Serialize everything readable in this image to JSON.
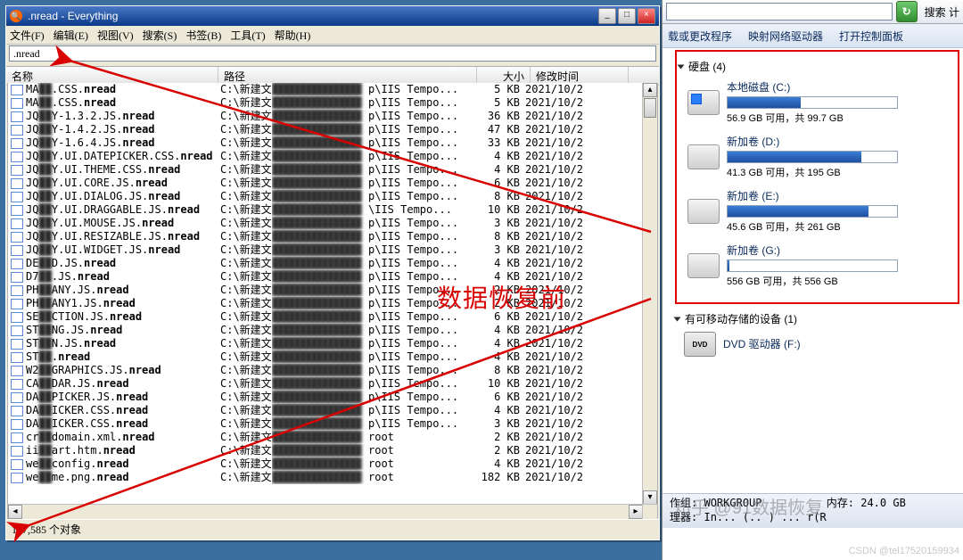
{
  "window": {
    "title": ".nread - Everything",
    "search_value": ".nread",
    "status": "167,585 个对象"
  },
  "menu": {
    "file": "文件(F)",
    "edit": "编辑(E)",
    "view": "视图(V)",
    "search": "搜索(S)",
    "bookmark": "书签(B)",
    "tool": "工具(T)",
    "help": "帮助(H)"
  },
  "cols": {
    "name": "名称",
    "path": "路径",
    "size": "大小",
    "date": "修改时间"
  },
  "overlay_text": "数据恢复前",
  "rows": [
    {
      "n1": "MA",
      "n2": ".CSS.",
      "n3": "nread",
      "pa": "C:\\新建文",
      "pb": "████████",
      "pc": "p\\IIS Tempo...",
      "sz": "5 KB",
      "dt": "2021/10/2"
    },
    {
      "n1": "MA",
      "n2": ".CSS.",
      "n3": "nread",
      "pa": "C:\\新建文",
      "pb": "████████",
      "pc": "p\\IIS Tempo...",
      "sz": "5 KB",
      "dt": "2021/10/2"
    },
    {
      "n1": "JQ",
      "n2": "Y-1.3.2.JS.",
      "n3": "nread",
      "pa": "C:\\新建文",
      "pb": "████████",
      "pc": "p\\IIS Tempo...",
      "sz": "36 KB",
      "dt": "2021/10/2"
    },
    {
      "n1": "JQ",
      "n2": "Y-1.4.2.JS.",
      "n3": "nread",
      "pa": "C:\\新建文",
      "pb": "████████",
      "pc": "p\\IIS Tempo...",
      "sz": "47 KB",
      "dt": "2021/10/2"
    },
    {
      "n1": "JQ",
      "n2": "Y-1.6.4.JS.",
      "n3": "nread",
      "pa": "C:\\新建文",
      "pb": "████████",
      "pc": "p\\IIS Tempo...",
      "sz": "33 KB",
      "dt": "2021/10/2"
    },
    {
      "n1": "JQ",
      "n2": "Y.UI.DATEPICKER.CSS.",
      "n3": "nread",
      "pa": "C:\\新建文",
      "pb": "████████",
      "pc": "p\\IIS Tempo...",
      "sz": "4 KB",
      "dt": "2021/10/2"
    },
    {
      "n1": "JQ",
      "n2": "Y.UI.THEME.CSS.",
      "n3": "nread",
      "pa": "C:\\新建文",
      "pb": "████████",
      "pc": "p\\IIS Tempo...",
      "sz": "4 KB",
      "dt": "2021/10/2"
    },
    {
      "n1": "JQ",
      "n2": "Y.UI.CORE.JS.",
      "n3": "nread",
      "pa": "C:\\新建文",
      "pb": "████████",
      "pc": "p\\IIS Tempo...",
      "sz": "6 KB",
      "dt": "2021/10/2"
    },
    {
      "n1": "JQ",
      "n2": "Y.UI.DIALOG.JS.",
      "n3": "nread",
      "pa": "C:\\新建文",
      "pb": "████████",
      "pc": "p\\IIS Tempo...",
      "sz": "8 KB",
      "dt": "2021/10/2"
    },
    {
      "n1": "JQ",
      "n2": "Y.UI.DRAGGABLE.JS.",
      "n3": "nread",
      "pa": "C:\\新建文",
      "pb": "████████",
      "pc": "\\IIS Tempo...",
      "sz": "10 KB",
      "dt": "2021/10/2"
    },
    {
      "n1": "JQ",
      "n2": "Y.UI.MOUSE.JS.",
      "n3": "nread",
      "pa": "C:\\新建文",
      "pb": "████████",
      "pc": "p\\IIS Tempo...",
      "sz": "3 KB",
      "dt": "2021/10/2"
    },
    {
      "n1": "JQ",
      "n2": "Y.UI.RESIZABLE.JS.",
      "n3": "nread",
      "pa": "C:\\新建文",
      "pb": "████████",
      "pc": "p\\IIS Tempo...",
      "sz": "8 KB",
      "dt": "2021/10/2"
    },
    {
      "n1": "JQ",
      "n2": "Y.UI.WIDGET.JS.",
      "n3": "nread",
      "pa": "C:\\新建文",
      "pb": "████████",
      "pc": "p\\IIS Tempo...",
      "sz": "3 KB",
      "dt": "2021/10/2"
    },
    {
      "n1": "DE",
      "n2": "D.JS.",
      "n3": "nread",
      "pa": "C:\\新建文",
      "pb": "████████",
      "pc": "p\\IIS Tempo...",
      "sz": "4 KB",
      "dt": "2021/10/2"
    },
    {
      "n1": "D7",
      "n2": ".JS.",
      "n3": "nread",
      "pa": "C:\\新建文",
      "pb": "████████",
      "pc": "p\\IIS Tempo...",
      "sz": "4 KB",
      "dt": "2021/10/2"
    },
    {
      "n1": "PH",
      "n2": "ANY.JS.",
      "n3": "nread",
      "pa": "C:\\新建文",
      "pb": "████████",
      "pc": "p\\IIS Tempo...",
      "sz": "2 KB",
      "dt": "2021/10/2"
    },
    {
      "n1": "PH",
      "n2": "ANY1.JS.",
      "n3": "nread",
      "pa": "C:\\新建文",
      "pb": "████████",
      "pc": "p\\IIS Tempo...",
      "sz": "2 KB",
      "dt": "2021/10/2"
    },
    {
      "n1": "SE",
      "n2": "CTION.JS.",
      "n3": "nread",
      "pa": "C:\\新建文",
      "pb": "████████",
      "pc": "p\\IIS Tempo...",
      "sz": "6 KB",
      "dt": "2021/10/2"
    },
    {
      "n1": "ST",
      "n2": "NG.JS.",
      "n3": "nread",
      "pa": "C:\\新建文",
      "pb": "████████",
      "pc": "p\\IIS Tempo...",
      "sz": "4 KB",
      "dt": "2021/10/2"
    },
    {
      "n1": "ST",
      "n2": "N.JS.",
      "n3": "nread",
      "pa": "C:\\新建文",
      "pb": "████████",
      "pc": "p\\IIS Tempo...",
      "sz": "4 KB",
      "dt": "2021/10/2"
    },
    {
      "n1": "ST",
      "n2": ".",
      "n3": "nread",
      "pa": "C:\\新建文",
      "pb": "████████",
      "pc": "p\\IIS Tempo...",
      "sz": "4 KB",
      "dt": "2021/10/2"
    },
    {
      "n1": "W2",
      "n2": "GRAPHICS.JS.",
      "n3": "nread",
      "pa": "C:\\新建文",
      "pb": "████████",
      "pc": "p\\IIS Tempo...",
      "sz": "8 KB",
      "dt": "2021/10/2"
    },
    {
      "n1": "CA",
      "n2": "DAR.JS.",
      "n3": "nread",
      "pa": "C:\\新建文",
      "pb": "████████",
      "pc": "p\\IIS Tempo...",
      "sz": "10 KB",
      "dt": "2021/10/2"
    },
    {
      "n1": "DA",
      "n2": "PICKER.JS.",
      "n3": "nread",
      "pa": "C:\\新建文",
      "pb": "████████",
      "pc": "p\\IIS Tempo...",
      "sz": "6 KB",
      "dt": "2021/10/2"
    },
    {
      "n1": "DA",
      "n2": "ICKER.CSS.",
      "n3": "nread",
      "pa": "C:\\新建文",
      "pb": "████████",
      "pc": "p\\IIS Tempo...",
      "sz": "4 KB",
      "dt": "2021/10/2"
    },
    {
      "n1": "DA",
      "n2": "ICKER.CSS.",
      "n3": "nread",
      "pa": "C:\\新建文",
      "pb": "████████",
      "pc": "p\\IIS Tempo...",
      "sz": "3 KB",
      "dt": "2021/10/2"
    },
    {
      "n1": "cr",
      "n2": "domain.xml.",
      "n3": "nread",
      "pa": "C:\\新建文",
      "pb": "████████",
      "pc": "root",
      "sz": "2 KB",
      "dt": "2021/10/2"
    },
    {
      "n1": "ii",
      "n2": "art.htm.",
      "n3": "nread",
      "pa": "C:\\新建文",
      "pb": "████████",
      "pc": "root",
      "sz": "2 KB",
      "dt": "2021/10/2"
    },
    {
      "n1": "we",
      "n2": "config.",
      "n3": "nread",
      "pa": "C:\\新建文",
      "pb": "████████",
      "pc": "root",
      "sz": "4 KB",
      "dt": "2021/10/2"
    },
    {
      "n1": "we",
      "n2": "me.png.",
      "n3": "nread",
      "pa": "C:\\新建文",
      "pb": "████████",
      "pc": "root",
      "sz": "182 KB",
      "dt": "2021/10/2"
    }
  ],
  "explorer": {
    "search_hint": "搜索 计",
    "toolbar": {
      "uninstall": "载或更改程序",
      "netdrv": "映射网络驱动器",
      "ctrlpanel": "打开控制面板"
    },
    "section_disk": "硬盘 (4)",
    "section_removable": "有可移动存储的设备 (1)",
    "drives": [
      {
        "label": "本地磁盘 (C:)",
        "free": "56.9 GB 可用，共 99.7 GB",
        "pct": 43,
        "win": true
      },
      {
        "label": "新加卷 (D:)",
        "free": "41.3 GB 可用，共 195 GB",
        "pct": 79,
        "win": false
      },
      {
        "label": "新加卷 (E:)",
        "free": "45.6 GB 可用，共 261 GB",
        "pct": 83,
        "win": false
      },
      {
        "label": "新加卷 (G:)",
        "free": "556 GB 可用，共 556 GB",
        "pct": 1,
        "win": false
      }
    ],
    "dvd": "DVD 驱动器 (F:)",
    "status": {
      "l1a": "作组:",
      "l1b": "WORKGROUP",
      "l1c": "内存:",
      "l1d": "24.0 GB",
      "l2a": "理器:",
      "l2b": "In... (.. ) ... r(R"
    }
  },
  "watermarks": {
    "csdn": "CSDN @tel17520159934",
    "zhihu": "知乎 @91数据恢复"
  }
}
